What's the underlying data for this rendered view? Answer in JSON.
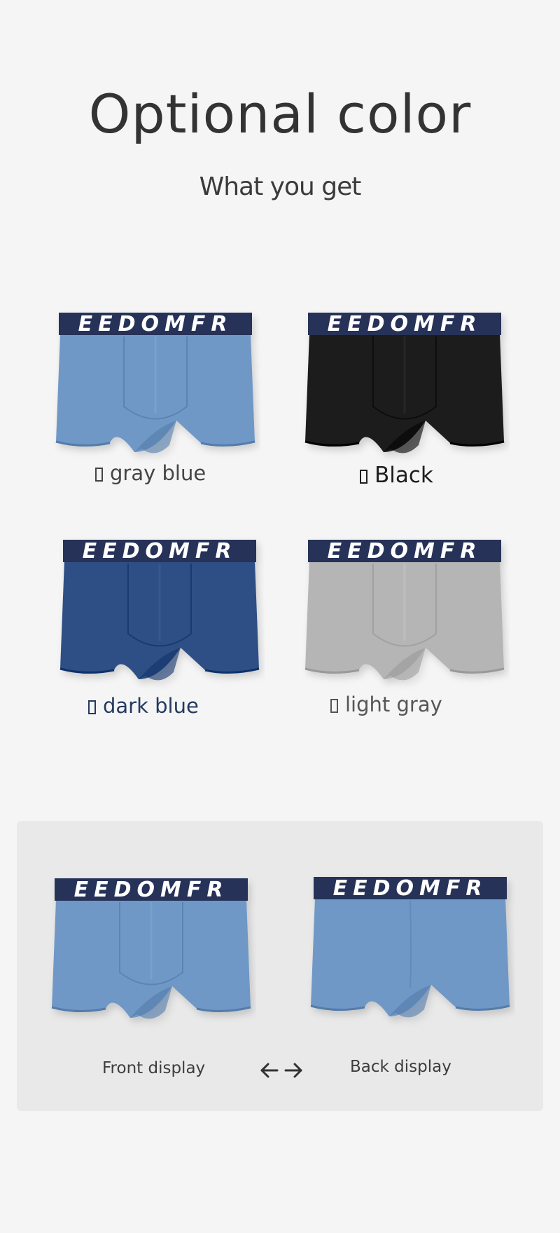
{
  "header": {
    "title": "Optional color",
    "subtitle": "What you get"
  },
  "waistband_text": "EEDOMFR",
  "colors": [
    {
      "label": "gray blue",
      "fill": "#6f98c6"
    },
    {
      "label": "Black",
      "fill": "#1c1c1e"
    },
    {
      "label": "dark blue",
      "fill": "#2d4f85"
    },
    {
      "label": "light gray",
      "fill": "#b5b5b5"
    }
  ],
  "waistband_color": "#263159",
  "display": {
    "front_label": "Front display",
    "back_label": "Back display",
    "fill": "#6f98c6",
    "prev_icon": "arrow-left-icon",
    "next_icon": "arrow-right-icon"
  }
}
